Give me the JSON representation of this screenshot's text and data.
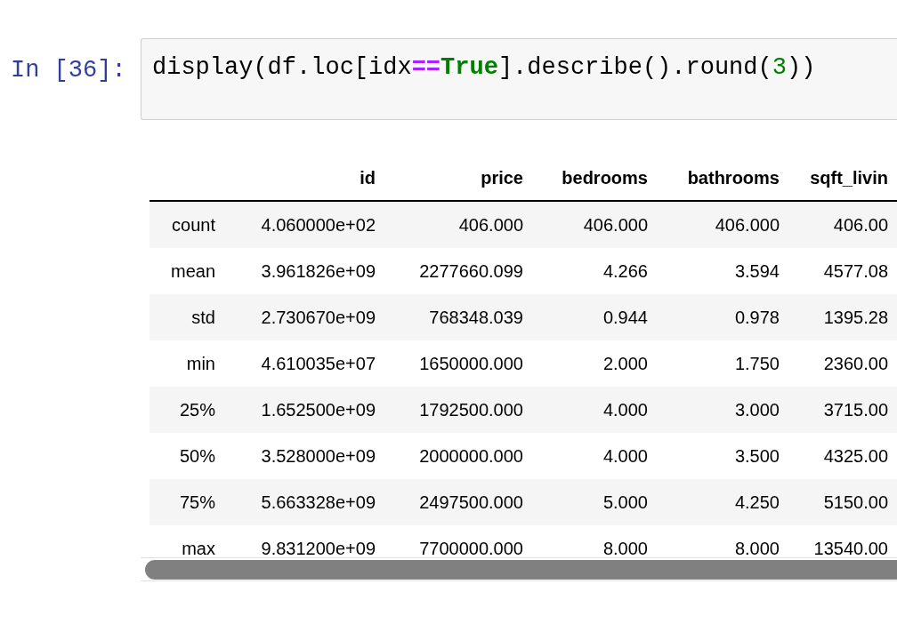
{
  "cell": {
    "prompt": "In [36]:",
    "code": [
      {
        "text": "display(df.loc[idx",
        "kind": "plain"
      },
      {
        "text": "==",
        "kind": "operator"
      },
      {
        "text": "True",
        "kind": "keyword"
      },
      {
        "text": "].describe().round(",
        "kind": "plain"
      },
      {
        "text": "3",
        "kind": "number"
      },
      {
        "text": "))",
        "kind": "plain"
      }
    ]
  },
  "table": {
    "columns": [
      "id",
      "price",
      "bedrooms",
      "bathrooms",
      "sqft_livin"
    ],
    "rows": [
      {
        "index": "count",
        "cells": [
          "4.060000e+02",
          "406.000",
          "406.000",
          "406.000",
          "406.00"
        ]
      },
      {
        "index": "mean",
        "cells": [
          "3.961826e+09",
          "2277660.099",
          "4.266",
          "3.594",
          "4577.08"
        ]
      },
      {
        "index": "std",
        "cells": [
          "2.730670e+09",
          "768348.039",
          "0.944",
          "0.978",
          "1395.28"
        ]
      },
      {
        "index": "min",
        "cells": [
          "4.610035e+07",
          "1650000.000",
          "2.000",
          "1.750",
          "2360.00"
        ]
      },
      {
        "index": "25%",
        "cells": [
          "1.652500e+09",
          "1792500.000",
          "4.000",
          "3.000",
          "3715.00"
        ]
      },
      {
        "index": "50%",
        "cells": [
          "3.528000e+09",
          "2000000.000",
          "4.000",
          "3.500",
          "4325.00"
        ]
      },
      {
        "index": "75%",
        "cells": [
          "5.663328e+09",
          "2497500.000",
          "5.000",
          "4.250",
          "5150.00"
        ]
      },
      {
        "index": "max",
        "cells": [
          "9.831200e+09",
          "7700000.000",
          "8.000",
          "8.000",
          "13540.00"
        ]
      }
    ]
  }
}
